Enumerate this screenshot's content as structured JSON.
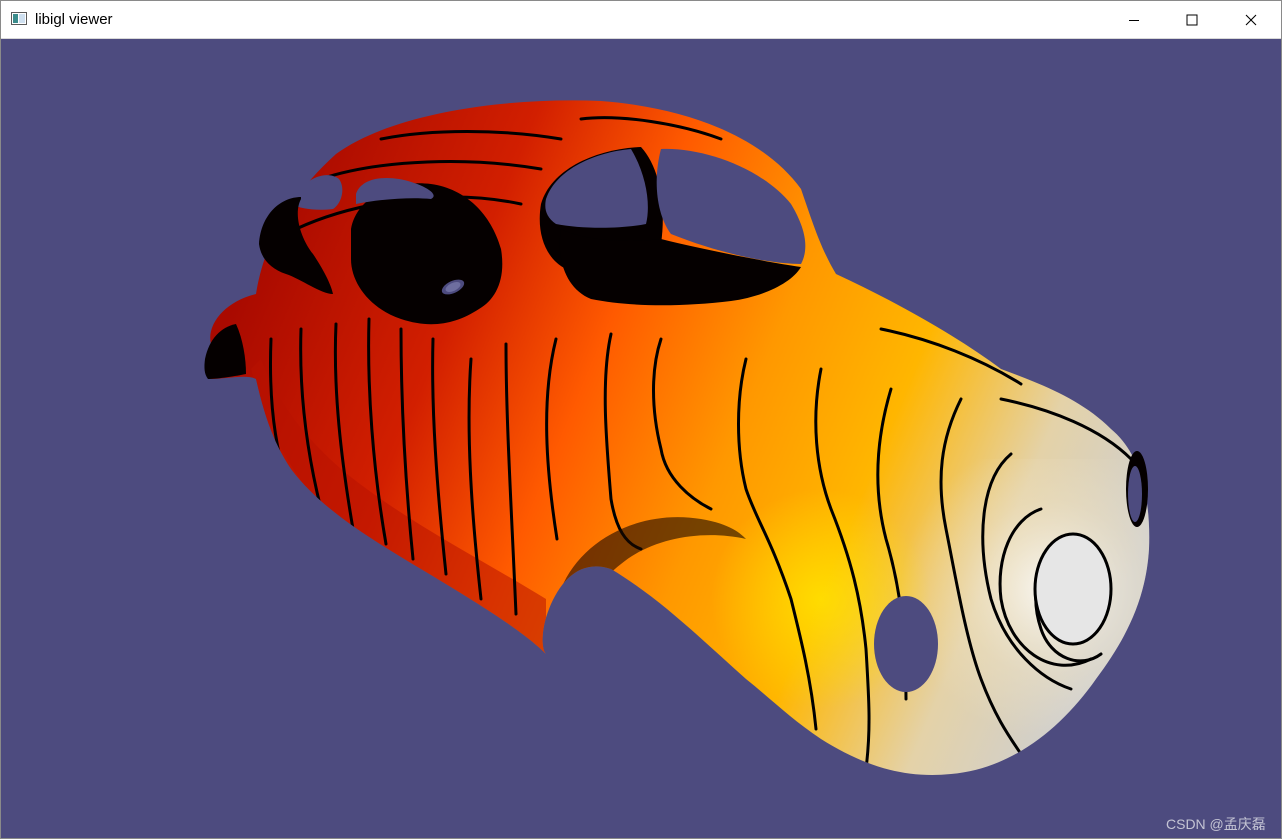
{
  "window": {
    "title": "libigl viewer",
    "controls": {
      "minimize_icon": "minimize-icon",
      "maximize_icon": "maximize-icon",
      "close_icon": "close-icon"
    }
  },
  "viewport": {
    "background_color": "#4d4b7f",
    "model": "car-body-mesh",
    "color_gradient": [
      "#b80c00",
      "#ff5a00",
      "#ffb200",
      "#e0d4b0",
      "#d8d8d8"
    ],
    "isoline_color": "#000000"
  },
  "watermark": {
    "text": "CSDN @孟庆磊"
  }
}
